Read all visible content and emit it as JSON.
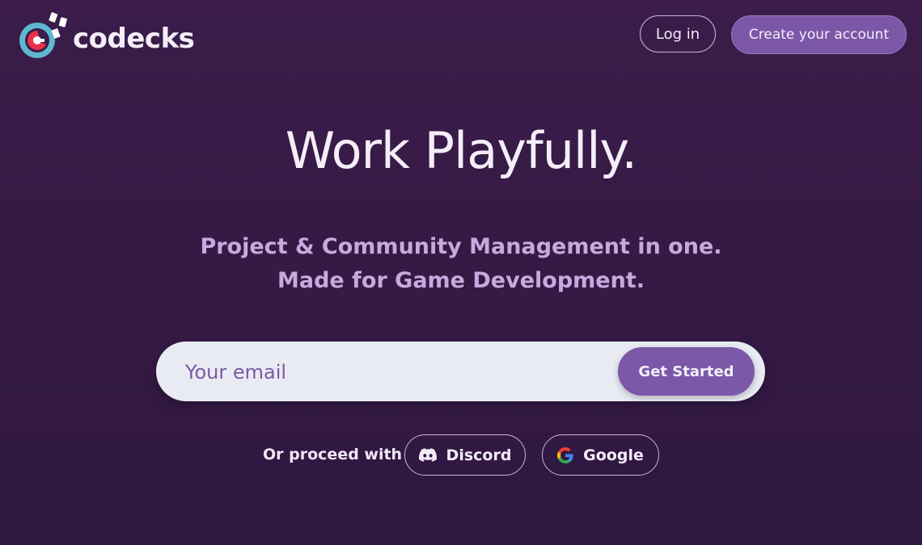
{
  "header": {
    "brand_name": "codecks",
    "login_label": "Log in",
    "create_account_label": "Create your account"
  },
  "hero": {
    "title": "Work Playfully.",
    "subtitle_line1": "Project & Community Management in one.",
    "subtitle_line2": "Made for Game Development."
  },
  "signup": {
    "email_placeholder": "Your email",
    "email_value": "",
    "submit_label": "Get Started"
  },
  "social": {
    "proceed_label": "Or proceed with",
    "discord_label": "Discord",
    "google_label": "Google",
    "discord_icon": "discord-icon",
    "google_icon": "google-icon"
  },
  "colors": {
    "background": "#3b1c4a",
    "accent": "#7c57a8",
    "subtitle": "#c8a9df",
    "input_bg": "#e9ebf3",
    "logo_red": "#e8304a",
    "logo_teal": "#5fb8cf"
  }
}
